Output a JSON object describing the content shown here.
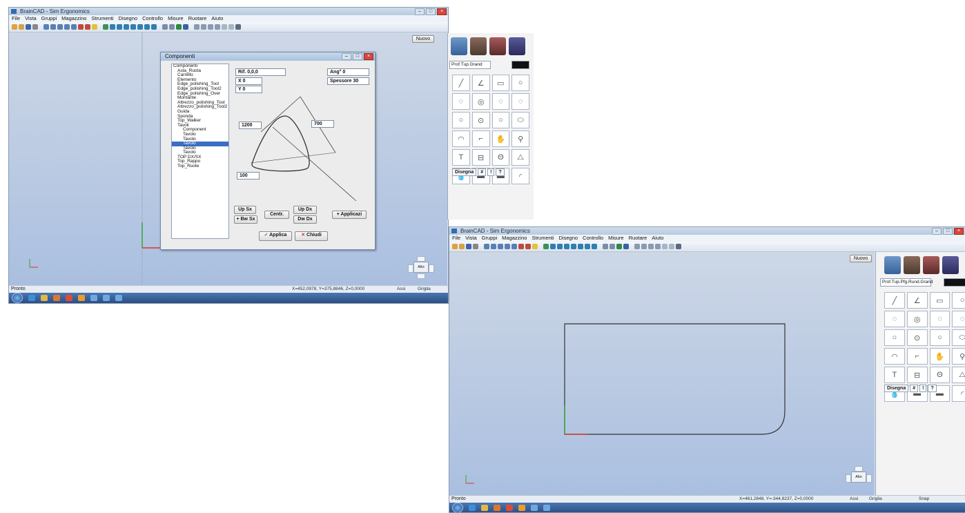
{
  "shot1": {
    "title": "BrainCAD - Sim Ergonomics",
    "menu": [
      "File",
      "Vista",
      "Gruppi",
      "Magazzino",
      "Strumenti",
      "Disegno",
      "Controllo",
      "Misure",
      "Ruotare",
      "Aiuto"
    ],
    "new_button": "Nuovo",
    "dialog": {
      "title": "Componenti",
      "tree_root": "Componenti",
      "tree_items": [
        "Asta_Ruota",
        "Carrello",
        "Elemento",
        "Edge_polishing_Tool",
        "Edge_polishing_Tool2",
        "Edge_polishing_Over",
        "Montante",
        "Attrezzo_polishing_Tool",
        "Attrezzo_polishing_Tool2",
        "Guida",
        "Sponda",
        "Top_Walker",
        "Tavoli"
      ],
      "tree_sub_items": [
        "Component",
        "Tavolo",
        "Tavolo",
        "Tavolo",
        "Tavolo",
        "Tavolo"
      ],
      "tree_tail_items": [
        "TOP DX/SX",
        "Top_Rappo",
        "Top_Ruote"
      ],
      "field_ref": "Rif.  0,0,0",
      "field_x": "X    0",
      "field_y": "Y    0",
      "field_ang": "Ang°    0",
      "field_spess": "Spessore   30",
      "dim_left": "1200",
      "dim_right": "700",
      "dim_bottom": "100",
      "btn_upsx": "Up Sx",
      "btn_bwsx": "+ Bw Sx",
      "btn_centr": "Centr.",
      "btn_updx": "Up Dx",
      "btn_dwdx": "Dw Dx",
      "btn_applica_small": "+ Applicazi",
      "btn_applica": "Applica",
      "btn_chiudi": "Chiudi"
    },
    "panel": {
      "profile_label": "Prof.Tup.Grand",
      "tab_label": "Disegna",
      "tools": [
        "line",
        "slash",
        "rect",
        "circle",
        "arc",
        "arc2",
        "arc3",
        "arc4",
        "circ",
        "circ2",
        "circ3",
        "ellipse",
        "arc5",
        "corner",
        "hand",
        "pin",
        "T",
        "rect2",
        "theta",
        "angle",
        "drop",
        "block",
        "block2",
        "sweep"
      ]
    },
    "status_left": "Pronto",
    "status_right": "X=452,0978, Y=375,8846, Z=0,0000",
    "status_extra": "Assi",
    "status_extra2": "Griglia"
  },
  "shot2": {
    "title": "BrainCAD - Sim Ergonomics",
    "menu": [
      "File",
      "Vista",
      "Gruppi",
      "Magazzino",
      "Strumenti",
      "Disegno",
      "Controllo",
      "Misure",
      "Ruotare",
      "Aiuto"
    ],
    "new_button": "Nuovo",
    "panel": {
      "profile_label": "Prof.Tup.Pfg.Rund.Grand",
      "tab_label": "Disegna"
    },
    "status_left": "Pronto",
    "status_right": "X=461,2848, Y=-344,8237, Z=0,0000",
    "status_extra": "Assi",
    "status_extra2": "Griglia",
    "status_extra3": "Snap"
  },
  "colors": {
    "canvas_top": "#cdd7e6",
    "canvas_bottom": "#aabfe0",
    "axis_x": "#d43a2a",
    "axis_y": "#3aa33a",
    "taskbar": "#2c4e82"
  }
}
